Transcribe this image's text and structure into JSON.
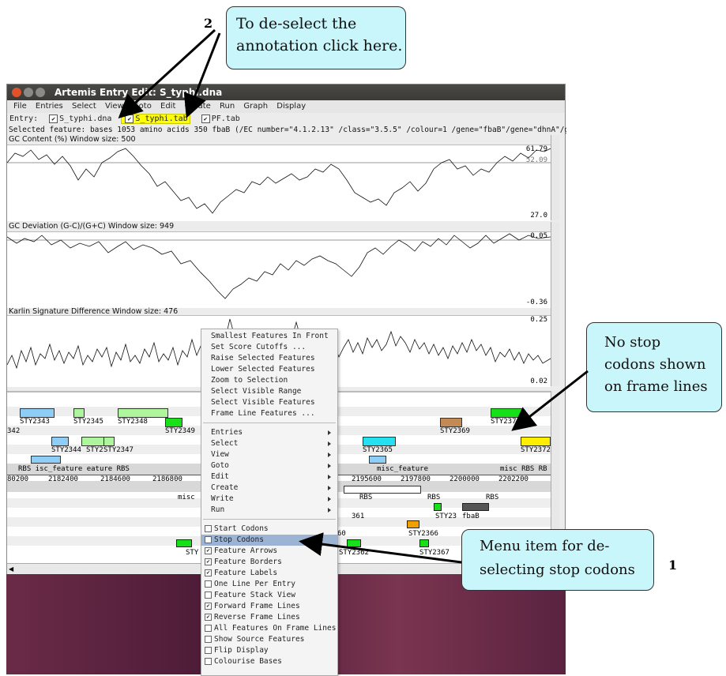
{
  "annotations": {
    "num_top": "2",
    "callout_top_line1": "To de-select the",
    "callout_top_line2": "annotation click here.",
    "callout_right_line1": "No stop",
    "callout_right_line2": "codons shown",
    "callout_right_line3": "on frame lines",
    "callout_bottom_line1": "Menu item for de-",
    "callout_bottom_line2": "selecting stop codons",
    "num_bottom": "1"
  },
  "window": {
    "title": "Artemis Entry Edit: S_typhi.dna",
    "menus": [
      "File",
      "Entries",
      "Select",
      "View",
      "Goto",
      "Edit",
      "Create",
      "Run",
      "Graph",
      "Display"
    ],
    "entry_label": "Entry:",
    "entries": [
      {
        "name": "S_typhi.dna",
        "checked": true,
        "highlight": false
      },
      {
        "name": "S_typhi.tab",
        "checked": true,
        "highlight": true
      },
      {
        "name": "PF.tab",
        "checked": true,
        "highlight": false
      }
    ],
    "selected_feature": "Selected feature:  bases 1053  amino acids 350  fbaB  (/EC number=\"4.1.2.13\" /class=\"3.5.5\" /colour=1 /gene=\"fbaB\"/gene=\"dhnA\"/g"
  },
  "graphs": [
    {
      "title": "GC Content (%)  Window size: 500",
      "max": "61.79",
      "mid": "52.09",
      "min": "27.0"
    },
    {
      "title": "GC Deviation (G-C)/(G+C)  Window size: 949",
      "max": "0.05",
      "min": "-0.36"
    },
    {
      "title": "Karlin Signature Difference  Window size: 476",
      "max": "0.25",
      "min": "0.02"
    }
  ],
  "feature_labels": {
    "stys_top": [
      "STY2343",
      "STY2345",
      "STY2348",
      "STY2349",
      "STY2369",
      "STY2371"
    ],
    "stys_mid": [
      "342",
      "STY2344",
      "STY2",
      "STY2347",
      "STY2365",
      "STY2372"
    ],
    "rbs_row": "RBS isc_feature  eature RBS",
    "misc_row": "misc_feature",
    "misc_right": "misc RBS RB",
    "misc_short": "misc",
    "coords": [
      "80200",
      "2182400",
      "2184600",
      "2186800",
      "2195600",
      "2197800",
      "2200000",
      "2202200"
    ],
    "rbs_lower": [
      "RBS",
      "RBS",
      "RBS"
    ],
    "lower_labels": [
      "361",
      "STY23",
      "fbaB",
      "60",
      "STY2366",
      "STY2362",
      "STY2367",
      "STY"
    ]
  },
  "popup_menu": {
    "group1": [
      "Smallest Features In Front",
      "Set Score Cutoffs ...",
      "Raise Selected Features",
      "Lower Selected Features",
      "Zoom to Selection",
      "Select Visible Range",
      "Select Visible Features",
      "Frame Line Features ..."
    ],
    "group2": [
      "Entries",
      "Select",
      "View",
      "Goto",
      "Edit",
      "Create",
      "Write",
      "Run"
    ],
    "group3": [
      {
        "label": "Start Codons",
        "checked": false
      },
      {
        "label": "Stop Codons",
        "checked": false,
        "selected": true
      },
      {
        "label": "Feature Arrows",
        "checked": true
      },
      {
        "label": "Feature Borders",
        "checked": true
      },
      {
        "label": "Feature Labels",
        "checked": true
      },
      {
        "label": "One Line Per Entry",
        "checked": false
      },
      {
        "label": "Feature Stack View",
        "checked": false
      },
      {
        "label": "Forward Frame Lines",
        "checked": true
      },
      {
        "label": "Reverse Frame Lines",
        "checked": true
      },
      {
        "label": "All Features On Frame Lines",
        "checked": false
      },
      {
        "label": "Show Source Features",
        "checked": false
      },
      {
        "label": "Flip Display",
        "checked": false
      },
      {
        "label": "Colourise Bases",
        "checked": false
      }
    ]
  },
  "colors": {
    "callout_bg": "#c9f6fb",
    "titlebar": "#3c3b37",
    "entry_highlight": "#ffff00",
    "menu_selected": "#9db3d3",
    "desktop": "#5a2340"
  }
}
